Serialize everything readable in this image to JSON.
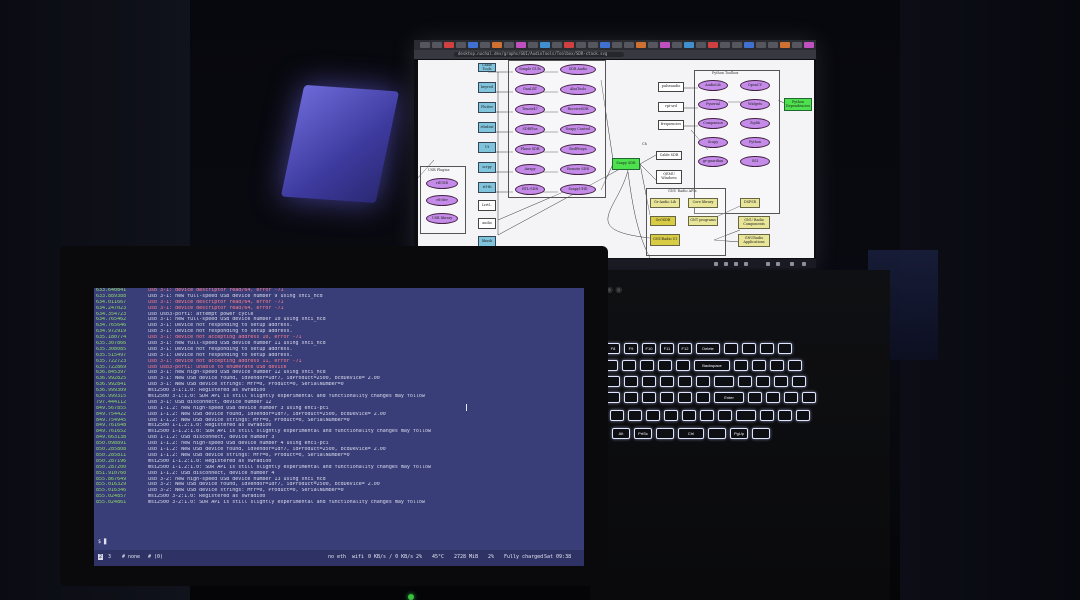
{
  "browser": {
    "url": "desktop.nuchal.dev/graphs/GUI/AudioTools/Toolbox/SDR-stack.svg"
  },
  "diagram": {
    "left_column": [
      "Cable Tools",
      "keyred",
      "Flutter",
      "rtlsdrat",
      "Ut",
      "scrpy",
      "rtl-tb",
      "Lrrtl..",
      "audio",
      "libusb"
    ],
    "mid_column_a": [
      "Simple GUIs",
      "GnuLRT",
      "Tenntr47",
      "SDRPlus",
      "Phase SDR",
      "Airspy",
      "RTL-SDR"
    ],
    "mid_column_b": [
      "SDR Audio",
      "AlsaTools",
      "ReceiveSDR",
      "Soapy Control",
      "RedPitaya",
      "Remote SDR",
      "SoapyUHD"
    ],
    "usb_plugins": {
      "title": "USB Plugins",
      "items": [
        "rtlUSB",
        "rtl-dev",
        "USB library"
      ]
    },
    "center_green": "Soapy SDR",
    "center_white": [
      "Cable SDR",
      "QEMU\nWindows"
    ],
    "right_inputs": [
      "pulseaudio",
      "rpi-srd",
      "frequencies"
    ],
    "python_toolbox": {
      "title": "Python Toolbox",
      "items": [
        "AudioLib",
        "Pyserial",
        "Companion",
        "Scapy",
        "gr-guardian",
        "OpenCV",
        "Widgets",
        "Ziplib",
        "Python",
        "SSI"
      ]
    },
    "right_green": "Python\nDependencies",
    "gnu_radio": {
      "title": "GNU Radio APIs",
      "items": [
        "Gr-Audio Lib",
        "Core library",
        "GrOSDR",
        "GNT programs",
        "GNURadio UI"
      ]
    },
    "right_outputs": [
      "DSPSR",
      "GNU Radio\nComponents",
      "GNURadio\nApplications"
    ],
    "edge_label": "Ch"
  },
  "terminal": {
    "lines": [
      {
        "t": "633.640841",
        "m": "usb 3-1: device descriptor read/64, error -71",
        "err": true
      },
      {
        "t": "633.889388",
        "m": "usb 3-1: new full-speed USB device number 9 using xhci_hcd",
        "err": false
      },
      {
        "t": "634.011667",
        "m": "usb 3-1: device descriptor read/64, error -71",
        "err": true
      },
      {
        "t": "634.247023",
        "m": "usb 3-1: device descriptor read/64, error -71",
        "err": true
      },
      {
        "t": "634.354723",
        "m": "usb usb3-port1: attempt power cycle",
        "err": false
      },
      {
        "t": "634.765462",
        "m": "usb 3-1: new full-speed USB device number 10 using xhci_hcd",
        "err": false
      },
      {
        "t": "634.765646",
        "m": "usb 3-1: Device not responding to setup address.",
        "err": false
      },
      {
        "t": "634.972919",
        "m": "usb 3-1: Device not responding to setup address.",
        "err": false
      },
      {
        "t": "635.180774",
        "m": "usb 3-1: device not accepting address 10, error -71",
        "err": true
      },
      {
        "t": "635.307866",
        "m": "usb 3-1: new full-speed USB device number 11 using xhci_hcd",
        "err": false
      },
      {
        "t": "635.308085",
        "m": "usb 3-1: Device not responding to setup address.",
        "err": false
      },
      {
        "t": "635.515497",
        "m": "usb 3-1: Device not responding to setup address.",
        "err": false
      },
      {
        "t": "635.722723",
        "m": "usb 3-1: device not accepting address 11, error -71",
        "err": true
      },
      {
        "t": "635.722869",
        "m": "usb usb3-port1: unable to enumerate USB device",
        "err": true
      },
      {
        "t": "636.845397",
        "m": "usb 3-1: new high-speed USB device number 12 using xhci_hcd",
        "err": false
      },
      {
        "t": "636.992825",
        "m": "usb 3-1: New USB device found, idVendor=1df7, idProduct=2500, bcdDevice= 2.00",
        "err": false
      },
      {
        "t": "636.992841",
        "m": "usb 3-1: New USB device strings: Mfr=0, Product=0, SerialNumber=0",
        "err": false
      },
      {
        "t": "636.999309",
        "m": "msi2500 3-1:1.0: Registered as swradio0",
        "err": false
      },
      {
        "t": "636.999315",
        "m": "msi2500 3-1:1.0: SDR API is still slightly experimental and functionality changes may follow",
        "err": false
      },
      {
        "t": "797.444112",
        "m": "usb 3-1: USB disconnect, device number 12",
        "err": false
      },
      {
        "t": "849.567855",
        "m": "usb 1-1.2: new high-speed USB device number 3 using ehci-pci",
        "err": false
      },
      {
        "t": "849.754422",
        "m": "usb 1-1.2: New USB device found, idVendor=1df7, idProduct=2500, bcdDevice= 2.00",
        "err": false
      },
      {
        "t": "849.754945",
        "m": "usb 1-1.2: New USB device strings: Mfr=0, Product=0, SerialNumber=0",
        "err": false
      },
      {
        "t": "849.761648",
        "m": "msi2500 1-1.2:1.0: Registered as swradio0",
        "err": false
      },
      {
        "t": "849.761652",
        "m": "msi2500 1-1.2:1.0: SDR API is still slightly experimental and functionality changes may follow",
        "err": false
      },
      {
        "t": "849.663138",
        "m": "usb 1-1.2: USB disconnect, device number 3",
        "err": false
      },
      {
        "t": "850.098891",
        "m": "usb 1-1.2: new high-speed USB device number 4 using ehci-pci",
        "err": false
      },
      {
        "t": "850.285808",
        "m": "usb 1-1.2: New USB device found, idVendor=1df7, idProduct=2500, bcdDevice= 2.00",
        "err": false
      },
      {
        "t": "850.285811",
        "m": "usb 1-1.2: New USB device strings: Mfr=0, Product=0, SerialNumber=0",
        "err": false
      },
      {
        "t": "850.287196",
        "m": "msi2500 1-1.2:1.0: Registered as swradio0",
        "err": false
      },
      {
        "t": "850.287200",
        "m": "msi2500 1-1.2:1.0: SDR API is still slightly experimental and functionality changes may follow",
        "err": false
      },
      {
        "t": "851.910760",
        "m": "usb 1-1.2: USB disconnect, device number 4",
        "err": false
      },
      {
        "t": "855.867649",
        "m": "usb 3-2: new high-speed USB device number 13 using xhci_hcd",
        "err": false
      },
      {
        "t": "855.016329",
        "m": "usb 3-2: New USB device found, idVendor=1df7, idProduct=2500, bcdDevice= 2.00",
        "err": false
      },
      {
        "t": "855.016346",
        "m": "usb 3-2: New USB device strings: Mfr=0, Product=0, SerialNumber=0",
        "err": false
      },
      {
        "t": "855.024857",
        "m": "msi2500 3-2:1.0: Registered as swradio0",
        "err": false
      },
      {
        "t": "855.024861",
        "m": "msi2500 3-2:1.0: SDR API is still slightly experimental and functionality changes may follow",
        "err": false
      }
    ],
    "prompt": "$ ▊"
  },
  "statusbar": {
    "workspaces": [
      "2",
      "3"
    ],
    "mode": "# none",
    "count": "# (0)",
    "eth": "no eth",
    "wifi": "wifi",
    "net": "0 KB/s / 0 KB/s",
    "cpu": "2%",
    "temp": "45°C",
    "mem": "2728 MiB",
    "disk": "2%",
    "battery": "Fully charged",
    "clock": "Sat 09:38"
  },
  "keyboard": {
    "row1": [
      "F8",
      "F9",
      "F10",
      "F11",
      "F12",
      "Delete",
      "",
      ""
    ],
    "row2": [
      "",
      "",
      "",
      "",
      "",
      "Backspace",
      "",
      ""
    ],
    "row3": [
      "",
      "",
      "",
      "",
      "",
      "",
      "",
      ""
    ],
    "row4": [
      "",
      "",
      "",
      "",
      "",
      "",
      "Enter",
      "",
      ""
    ],
    "row5": [
      "",
      "",
      "",
      "",
      "",
      "",
      "",
      "",
      ""
    ],
    "row6": [
      "Alt",
      "PrtSc",
      "",
      "Ctrl",
      "",
      "PgUp",
      ""
    ]
  }
}
